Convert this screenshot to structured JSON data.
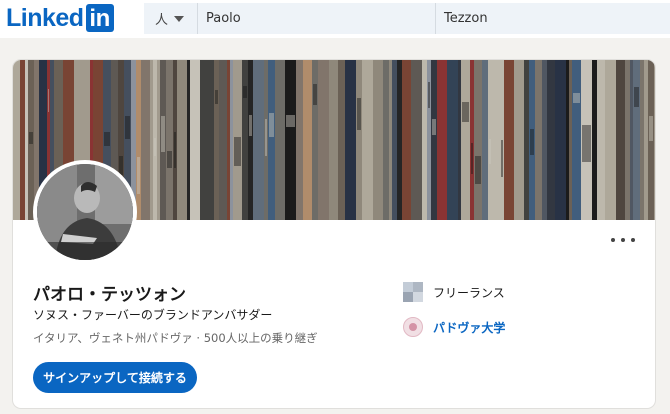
{
  "header": {
    "logo_text": "Linked",
    "logo_box_text": "in",
    "search_filter": "人",
    "first_name_value": "Paolo",
    "last_name_value": "Tezzon"
  },
  "profile": {
    "name": "パオロ・テッツォン",
    "headline": "ソヌス・ファーバーのブランドアンバサダー",
    "location": "イタリア、ヴェネト州パドヴァ · 500人以上の乗り継ぎ",
    "connect_label": "サインアップして接続する",
    "current_company": "フリーランス",
    "school": "パドヴァ大学"
  },
  "colors": {
    "brand": "#0a66c2",
    "background": "#f3f2ef"
  }
}
